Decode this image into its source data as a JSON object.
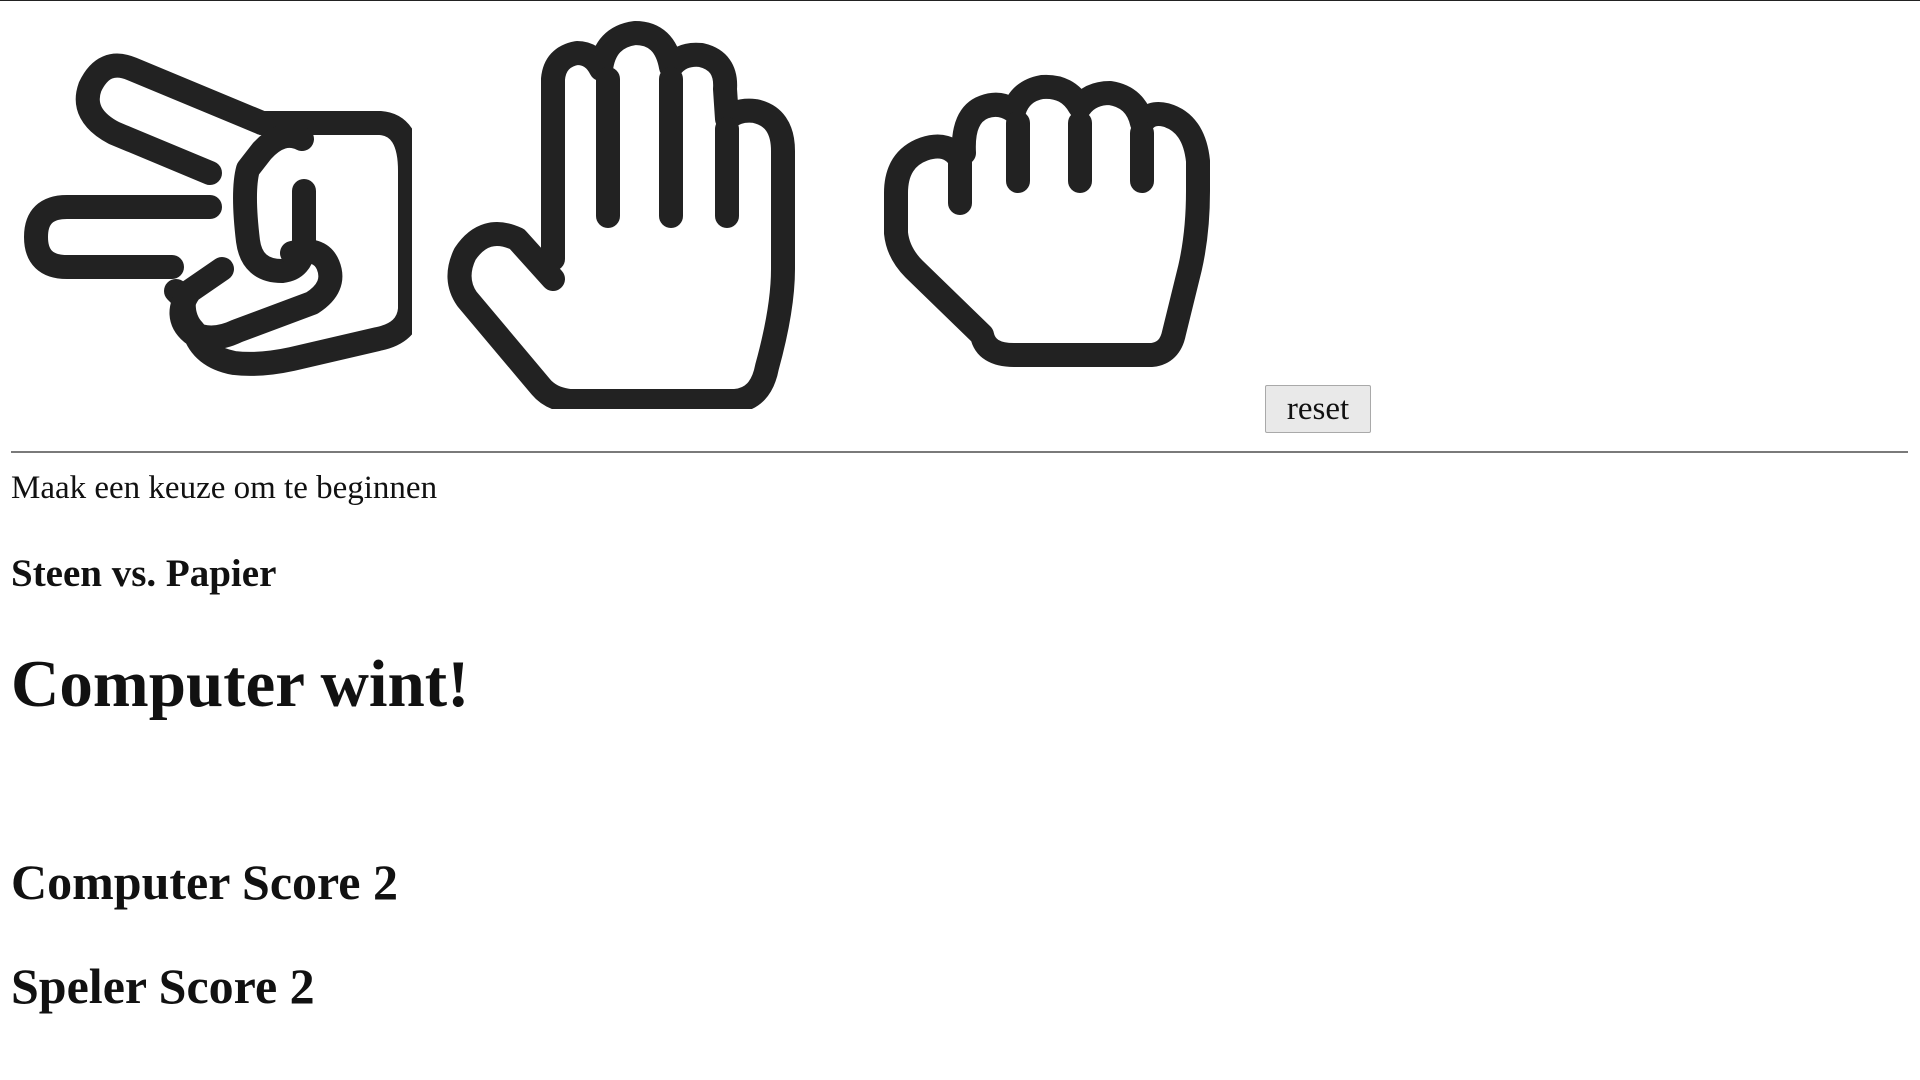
{
  "choices": [
    {
      "id": "scissors",
      "icon": "scissors-hand-icon"
    },
    {
      "id": "paper",
      "icon": "paper-hand-icon"
    },
    {
      "id": "rock",
      "icon": "rock-fist-icon"
    }
  ],
  "reset_label": "reset",
  "status_text": "Maak een keuze om te beginnen",
  "matchup_text": "Steen vs. Papier",
  "result_text": "Computer wint!",
  "scores": {
    "computer_label": "Computer Score 2",
    "player_label": "Speler Score 2",
    "computer": 2,
    "player": 2
  },
  "colors": {
    "icon_stroke": "#222222",
    "button_bg": "#e9e9e9"
  }
}
